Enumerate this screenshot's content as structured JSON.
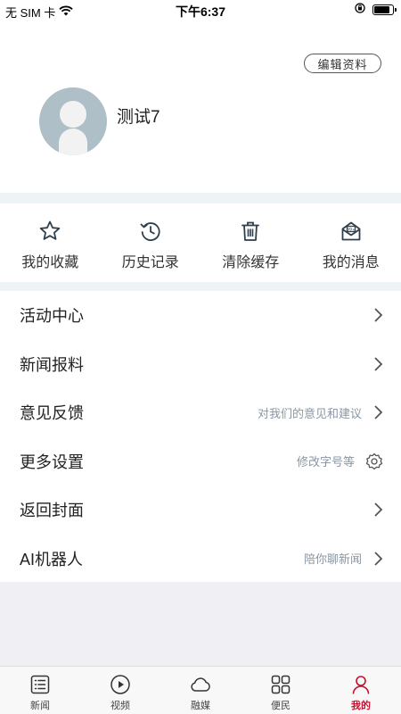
{
  "status_bar": {
    "carrier": "无 SIM 卡",
    "time": "下午6:37",
    "battery_level": 0.85
  },
  "profile": {
    "edit_label": "编辑资料",
    "username": "测试7"
  },
  "quick_actions": [
    {
      "label": "我的收藏",
      "icon": "star-icon"
    },
    {
      "label": "历史记录",
      "icon": "history-icon"
    },
    {
      "label": "清除缓存",
      "icon": "trash-icon"
    },
    {
      "label": "我的消息",
      "icon": "message-icon"
    }
  ],
  "menu": [
    {
      "title": "活动中心",
      "hint": "",
      "icon": "chevron-right-icon"
    },
    {
      "title": "新闻报料",
      "hint": "",
      "icon": "chevron-right-icon"
    },
    {
      "title": "意见反馈",
      "hint": "对我们的意见和建议",
      "icon": "chevron-right-icon"
    },
    {
      "title": "更多设置",
      "hint": "修改字号等",
      "icon": "gear-icon"
    },
    {
      "title": "返回封面",
      "hint": "",
      "icon": "chevron-right-icon"
    },
    {
      "title": "AI机器人",
      "hint": "陪你聊新闻",
      "icon": "chevron-right-icon"
    }
  ],
  "tabs": [
    {
      "label": "新闻",
      "icon": "news-list-icon",
      "active": false
    },
    {
      "label": "视频",
      "icon": "play-icon",
      "active": false
    },
    {
      "label": "融媒",
      "icon": "cloud-icon",
      "active": false
    },
    {
      "label": "便民",
      "icon": "grid-icon",
      "active": false
    },
    {
      "label": "我的",
      "icon": "person-icon",
      "active": true
    }
  ],
  "colors": {
    "accent": "#c8102e",
    "icon": "#2f3f4c",
    "avatar": "#aebfc8",
    "divider": "#eef3f6"
  }
}
